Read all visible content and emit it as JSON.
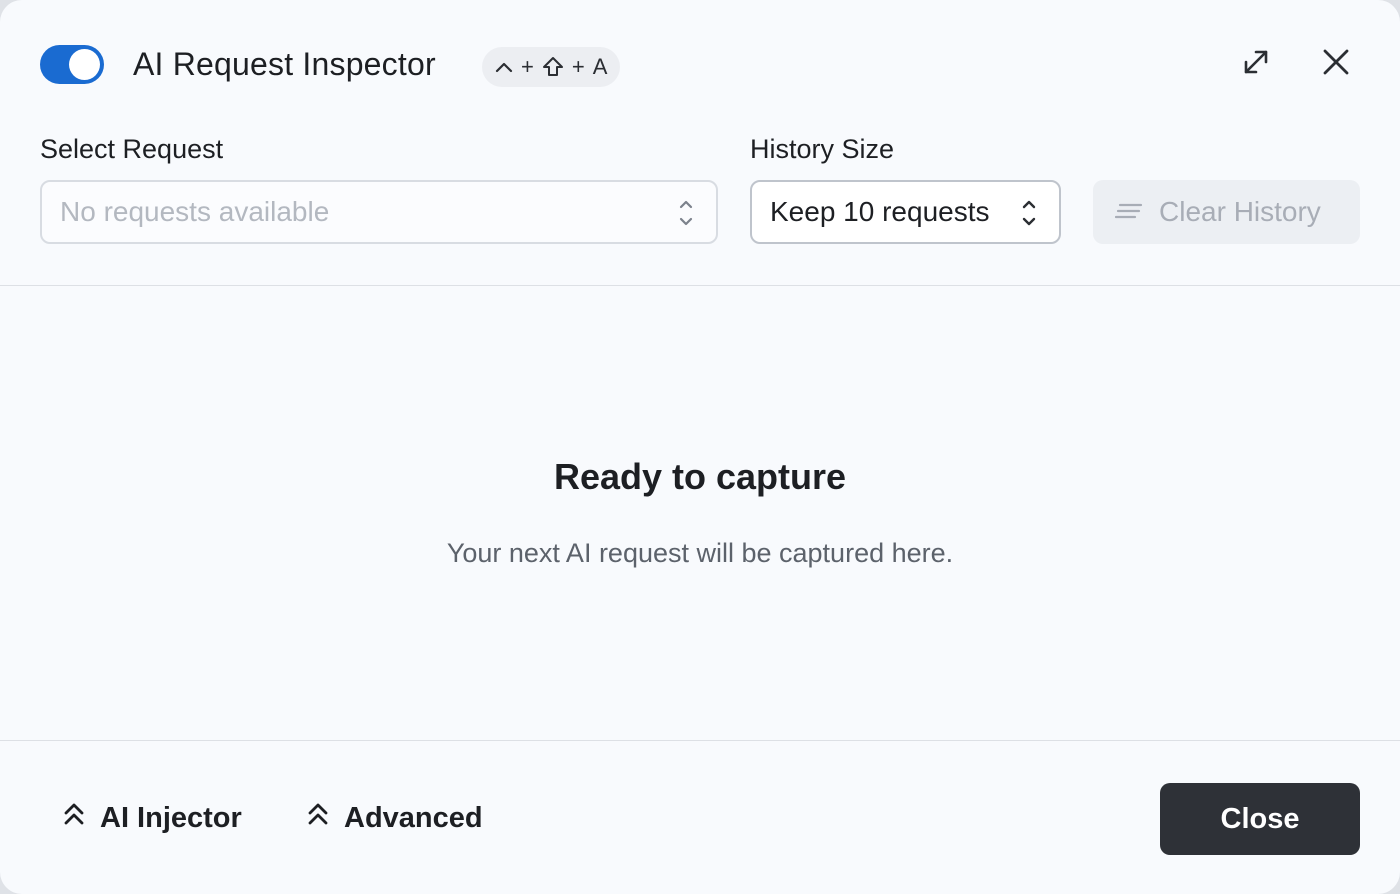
{
  "header": {
    "title": "AI Request Inspector",
    "toggle_on": true,
    "shortcut": {
      "keys": [
        "ctrl-caret-icon",
        "+",
        "shift-icon",
        "+",
        "A"
      ],
      "plus": "+",
      "letter": "A"
    },
    "icons": {
      "expand": "expand-icon",
      "close": "close-icon"
    }
  },
  "controls": {
    "select_request_label": "Select Request",
    "select_request_placeholder": "No requests available",
    "history_size_label": "History Size",
    "history_size_value": "Keep 10 requests",
    "clear_history_label": "Clear History"
  },
  "empty_state": {
    "title": "Ready to capture",
    "subtitle": "Your next AI request will be captured here."
  },
  "footer": {
    "injector_label": "AI Injector",
    "advanced_label": "Advanced",
    "close_label": "Close"
  },
  "colors": {
    "accent": "#1a6bd1",
    "primary_button": "#2e3137",
    "background": "#f8fafd"
  }
}
